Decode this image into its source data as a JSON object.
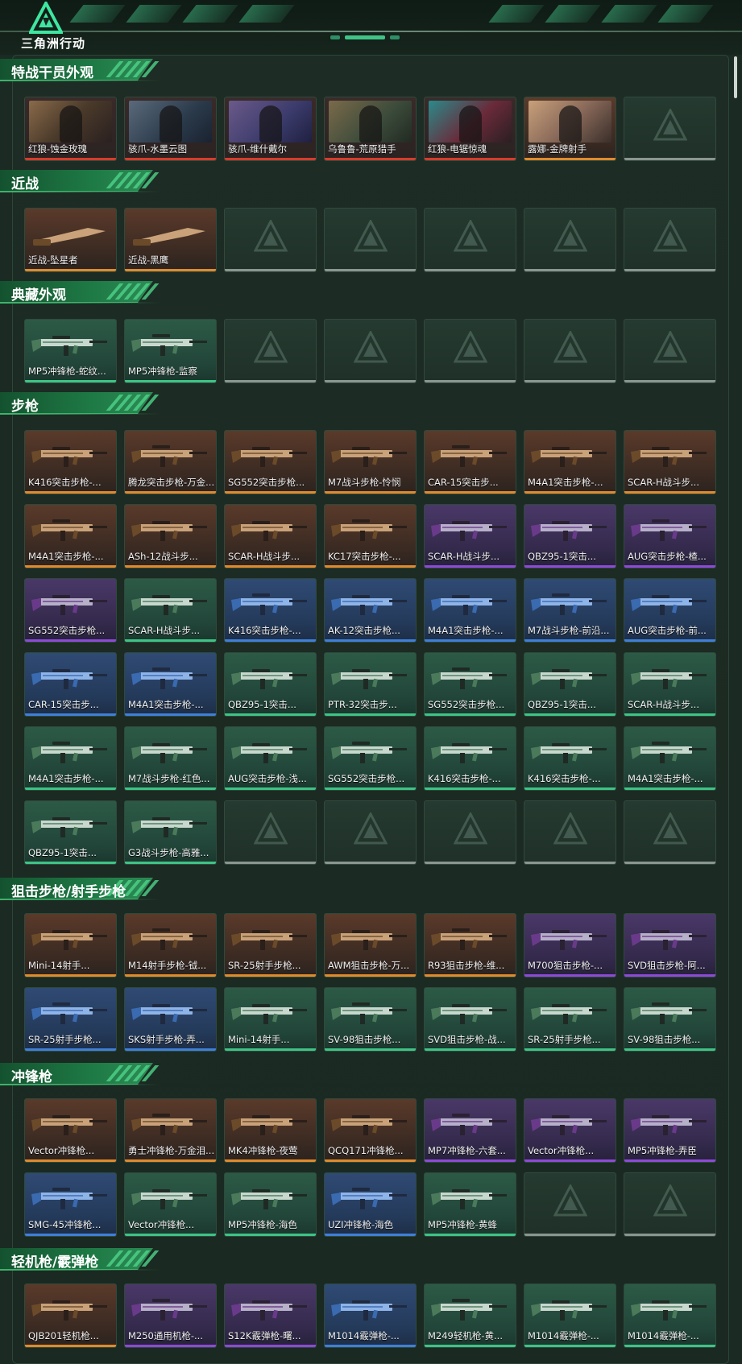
{
  "app": {
    "logo_text": "三角洲行动"
  },
  "colors": {
    "accent": "#3ec486",
    "brown": "#e08a2c",
    "purple": "#8d4ad6",
    "blue": "#3f7fd8",
    "green": "#3ec486",
    "red": "#d43c2c"
  },
  "sections": [
    {
      "title": "特战干员外观",
      "items": [
        {
          "label": "红狼-蚀金玫瑰",
          "rarity": "char"
        },
        {
          "label": "骇爪-水墨云图",
          "rarity": "char"
        },
        {
          "label": "骇爪-维什戴尔",
          "rarity": "char"
        },
        {
          "label": "乌鲁鲁-荒原猎手",
          "rarity": "char"
        },
        {
          "label": "红狼-电锯惊魂",
          "rarity": "char"
        },
        {
          "label": "露娜-金牌射手",
          "rarity": "brown"
        },
        {
          "label": "",
          "rarity": "empty"
        }
      ]
    },
    {
      "title": "近战",
      "items": [
        {
          "label": "近战-坠星者",
          "rarity": "brown",
          "icon": "knife-icon"
        },
        {
          "label": "近战-黑鹰",
          "rarity": "brown",
          "icon": "knife-icon"
        },
        {
          "label": "",
          "rarity": "empty"
        },
        {
          "label": "",
          "rarity": "empty"
        },
        {
          "label": "",
          "rarity": "empty"
        },
        {
          "label": "",
          "rarity": "empty"
        },
        {
          "label": "",
          "rarity": "empty"
        }
      ]
    },
    {
      "title": "典藏外观",
      "items": [
        {
          "label": "MP5冲锋枪-蛇纹...",
          "rarity": "green"
        },
        {
          "label": "MP5冲锋枪-监察",
          "rarity": "green"
        },
        {
          "label": "",
          "rarity": "empty"
        },
        {
          "label": "",
          "rarity": "empty"
        },
        {
          "label": "",
          "rarity": "empty"
        },
        {
          "label": "",
          "rarity": "empty"
        },
        {
          "label": "",
          "rarity": "empty"
        }
      ]
    },
    {
      "title": "步枪",
      "items": [
        {
          "label": "K416突击步枪-...",
          "rarity": "brown"
        },
        {
          "label": "腾龙突击步枪-万金...",
          "rarity": "brown"
        },
        {
          "label": "SG552突击步枪...",
          "rarity": "brown"
        },
        {
          "label": "M7战斗步枪-怜悯",
          "rarity": "brown"
        },
        {
          "label": "CAR-15突击步...",
          "rarity": "brown"
        },
        {
          "label": "M4A1突击步枪-...",
          "rarity": "brown"
        },
        {
          "label": "SCAR-H战斗步...",
          "rarity": "brown"
        },
        {
          "label": "M4A1突击步枪-...",
          "rarity": "brown"
        },
        {
          "label": "ASh-12战斗步...",
          "rarity": "brown"
        },
        {
          "label": "SCAR-H战斗步...",
          "rarity": "brown"
        },
        {
          "label": "KC17突击步枪-...",
          "rarity": "brown"
        },
        {
          "label": "SCAR-H战斗步...",
          "rarity": "purple"
        },
        {
          "label": "QBZ95-1突击...",
          "rarity": "purple"
        },
        {
          "label": "AUG突击步枪-楂...",
          "rarity": "purple"
        },
        {
          "label": "SG552突击步枪...",
          "rarity": "purple"
        },
        {
          "label": "SCAR-H战斗步...",
          "rarity": "green"
        },
        {
          "label": "K416突击步枪-...",
          "rarity": "blue"
        },
        {
          "label": "AK-12突击步枪...",
          "rarity": "blue"
        },
        {
          "label": "M4A1突击步枪-...",
          "rarity": "blue"
        },
        {
          "label": "M7战斗步枪-前沿...",
          "rarity": "blue"
        },
        {
          "label": "AUG突击步枪-前...",
          "rarity": "blue"
        },
        {
          "label": "CAR-15突击步...",
          "rarity": "blue"
        },
        {
          "label": "M4A1突击步枪-...",
          "rarity": "blue"
        },
        {
          "label": "QBZ95-1突击...",
          "rarity": "green"
        },
        {
          "label": "PTR-32突击步...",
          "rarity": "green"
        },
        {
          "label": "SG552突击步枪...",
          "rarity": "green"
        },
        {
          "label": "QBZ95-1突击...",
          "rarity": "green"
        },
        {
          "label": "SCAR-H战斗步...",
          "rarity": "green"
        },
        {
          "label": "M4A1突击步枪-...",
          "rarity": "green"
        },
        {
          "label": "M7战斗步枪-红色...",
          "rarity": "green"
        },
        {
          "label": "AUG突击步枪-浅...",
          "rarity": "green"
        },
        {
          "label": "SG552突击步枪...",
          "rarity": "green"
        },
        {
          "label": "K416突击步枪-...",
          "rarity": "green"
        },
        {
          "label": "K416突击步枪-...",
          "rarity": "green"
        },
        {
          "label": "M4A1突击步枪-...",
          "rarity": "green"
        },
        {
          "label": "QBZ95-1突击...",
          "rarity": "green"
        },
        {
          "label": "G3战斗步枪-高雅...",
          "rarity": "green"
        },
        {
          "label": "",
          "rarity": "empty"
        },
        {
          "label": "",
          "rarity": "empty"
        },
        {
          "label": "",
          "rarity": "empty"
        },
        {
          "label": "",
          "rarity": "empty"
        },
        {
          "label": "",
          "rarity": "empty"
        }
      ]
    },
    {
      "title": "狙击步枪/射手步枪",
      "items": [
        {
          "label": "Mini-14射手...",
          "rarity": "brown"
        },
        {
          "label": "M14射手步枪-钺...",
          "rarity": "brown"
        },
        {
          "label": "SR-25射手步枪...",
          "rarity": "brown"
        },
        {
          "label": "AWM狙击步枪-万...",
          "rarity": "brown"
        },
        {
          "label": "R93狙击步枪-维...",
          "rarity": "brown"
        },
        {
          "label": "M700狙击步枪-...",
          "rarity": "purple"
        },
        {
          "label": "SVD狙击步枪-阿...",
          "rarity": "purple"
        },
        {
          "label": "SR-25射手步枪...",
          "rarity": "blue"
        },
        {
          "label": "SKS射手步枪-弄...",
          "rarity": "blue"
        },
        {
          "label": "Mini-14射手...",
          "rarity": "green"
        },
        {
          "label": "SV-98狙击步枪...",
          "rarity": "green"
        },
        {
          "label": "SVD狙击步枪-战...",
          "rarity": "green"
        },
        {
          "label": "SR-25射手步枪...",
          "rarity": "green"
        },
        {
          "label": "SV-98狙击步枪...",
          "rarity": "green"
        }
      ]
    },
    {
      "title": "冲锋枪",
      "items": [
        {
          "label": "Vector冲锋枪...",
          "rarity": "brown"
        },
        {
          "label": "勇士冲锋枪-万金泪...",
          "rarity": "brown"
        },
        {
          "label": "MK4冲锋枪-夜莺",
          "rarity": "brown"
        },
        {
          "label": "QCQ171冲锋枪...",
          "rarity": "brown"
        },
        {
          "label": "MP7冲锋枪-六套...",
          "rarity": "purple"
        },
        {
          "label": "Vector冲锋枪...",
          "rarity": "purple"
        },
        {
          "label": "MP5冲锋枪-弄臣",
          "rarity": "purple"
        },
        {
          "label": "SMG-45冲锋枪...",
          "rarity": "blue"
        },
        {
          "label": "Vector冲锋枪...",
          "rarity": "green"
        },
        {
          "label": "MP5冲锋枪-海色",
          "rarity": "green"
        },
        {
          "label": "UZI冲锋枪-海色",
          "rarity": "blue"
        },
        {
          "label": "MP5冲锋枪-黄蜂",
          "rarity": "green"
        },
        {
          "label": "",
          "rarity": "empty"
        },
        {
          "label": "",
          "rarity": "empty"
        }
      ]
    },
    {
      "title": "轻机枪/霰弹枪",
      "items": [
        {
          "label": "QJB201轻机枪...",
          "rarity": "brown"
        },
        {
          "label": "M250通用机枪-...",
          "rarity": "purple"
        },
        {
          "label": "S12K霰弹枪-曙...",
          "rarity": "purple"
        },
        {
          "label": "M1014霰弹枪-...",
          "rarity": "blue"
        },
        {
          "label": "M249轻机枪-黄...",
          "rarity": "green"
        },
        {
          "label": "M1014霰弹枪-...",
          "rarity": "green"
        },
        {
          "label": "M1014霰弹枪-...",
          "rarity": "green"
        }
      ]
    }
  ]
}
